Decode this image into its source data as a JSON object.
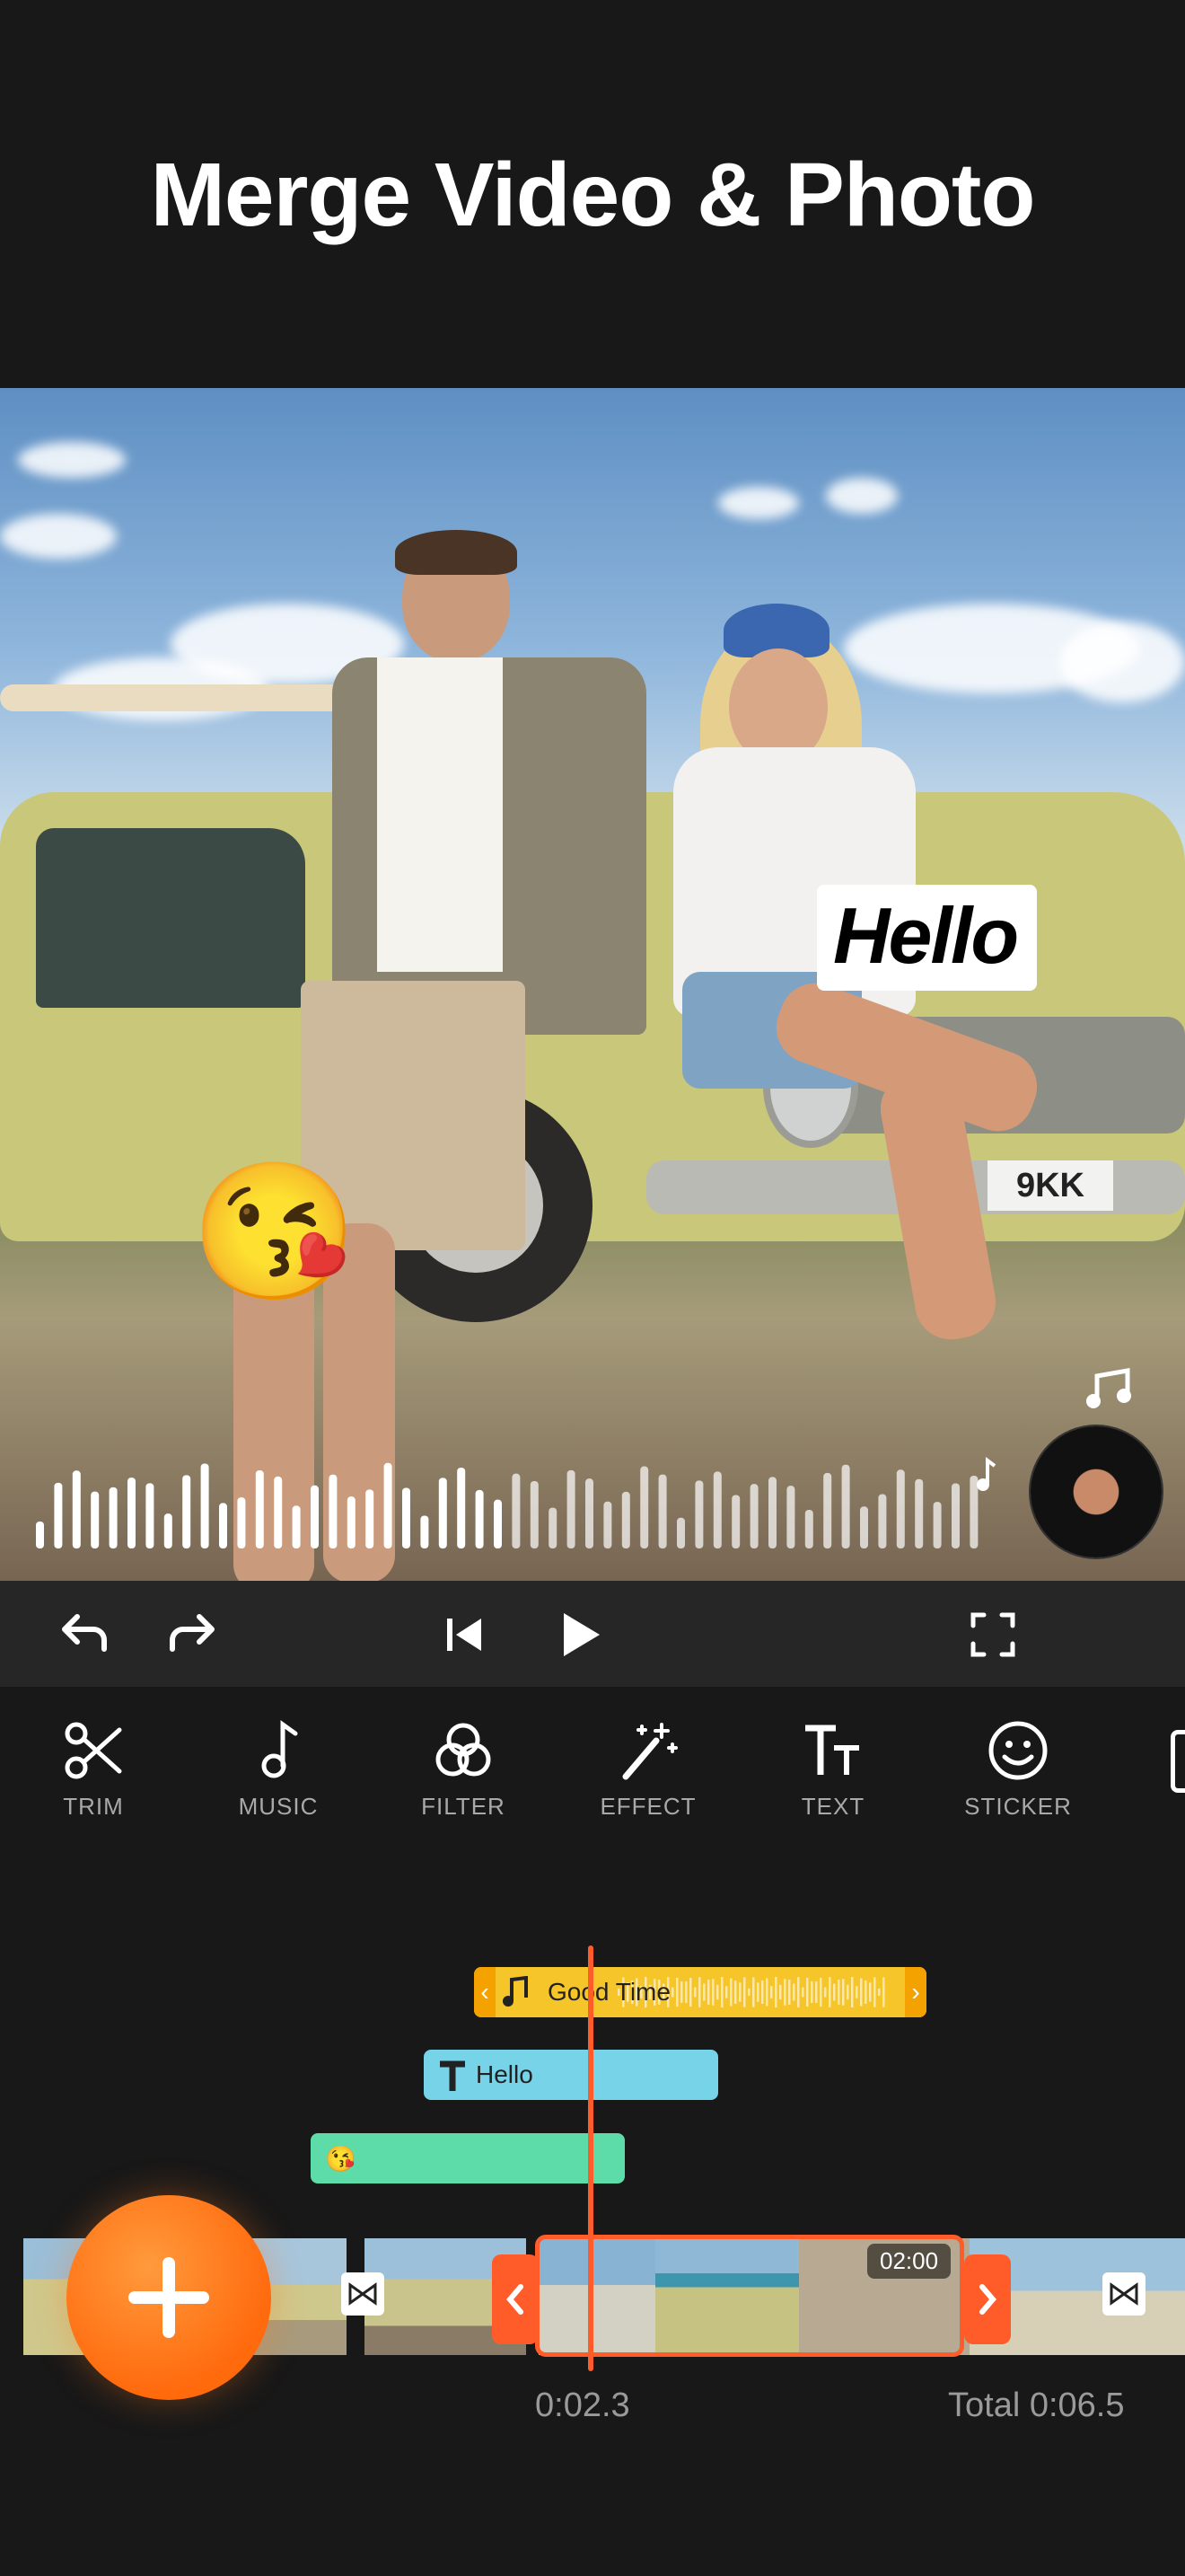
{
  "headline": "Merge Video & Photo",
  "preview": {
    "text_sticker": "Hello",
    "emoji_sticker": "😘",
    "plate_text": "9KK"
  },
  "controls": {
    "undo": "undo-icon",
    "redo": "redo-icon",
    "skip_back": "skip-to-start-icon",
    "play": "play-icon",
    "fullscreen": "fullscreen-icon"
  },
  "tools": [
    {
      "label": "TRIM",
      "icon": "scissors-icon"
    },
    {
      "label": "MUSIC",
      "icon": "music-note-icon"
    },
    {
      "label": "FILTER",
      "icon": "filter-circles-icon"
    },
    {
      "label": "EFFECT",
      "icon": "magic-wand-icon"
    },
    {
      "label": "TEXT",
      "icon": "text-icon"
    },
    {
      "label": "STICKER",
      "icon": "smiley-icon"
    }
  ],
  "timeline": {
    "music_track": "Good Time",
    "text_track": "Hello",
    "sticker_track": "😘",
    "clip_duration": "02:00",
    "current_time": "0:02.3",
    "total_time": "Total 0:06.5"
  },
  "colors": {
    "accent": "#ff5c2a",
    "music_track": "#f6c52a",
    "text_track": "#76d3e8",
    "sticker_track": "#5ddba8",
    "background": "#181818"
  }
}
